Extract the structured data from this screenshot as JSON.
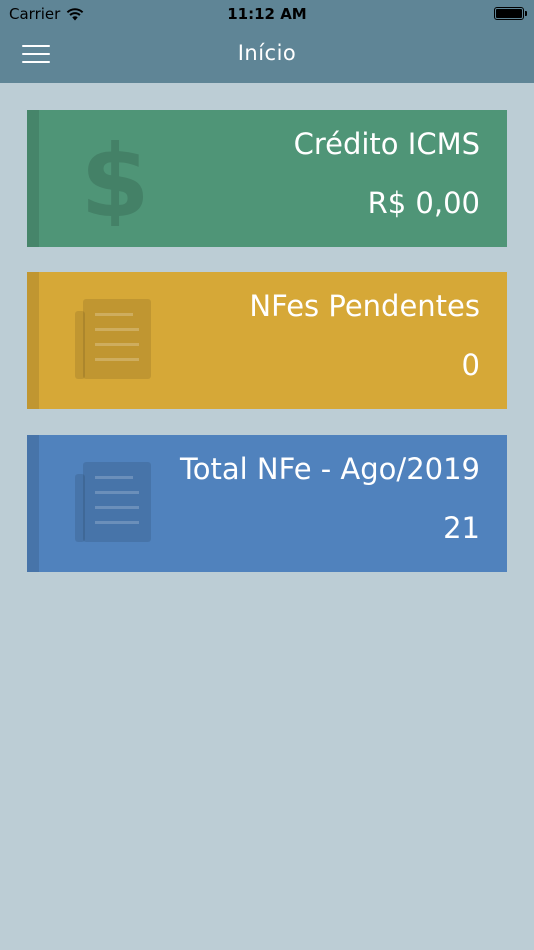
{
  "status_bar": {
    "carrier": "Carrier",
    "time": "11:12 AM"
  },
  "header": {
    "title": "Início"
  },
  "cards": [
    {
      "title": "Crédito ICMS",
      "value": "R$ 0,00",
      "icon": "dollar-icon",
      "color": "#4f9577"
    },
    {
      "title": "NFes Pendentes",
      "value": "0",
      "icon": "document-icon",
      "color": "#d6a837"
    },
    {
      "title": "Total NFe - Ago/2019",
      "value": "21",
      "icon": "document-icon",
      "color": "#5082bd"
    }
  ],
  "colors": {
    "navbar": "#5f8596",
    "background": "#bccdd5"
  }
}
